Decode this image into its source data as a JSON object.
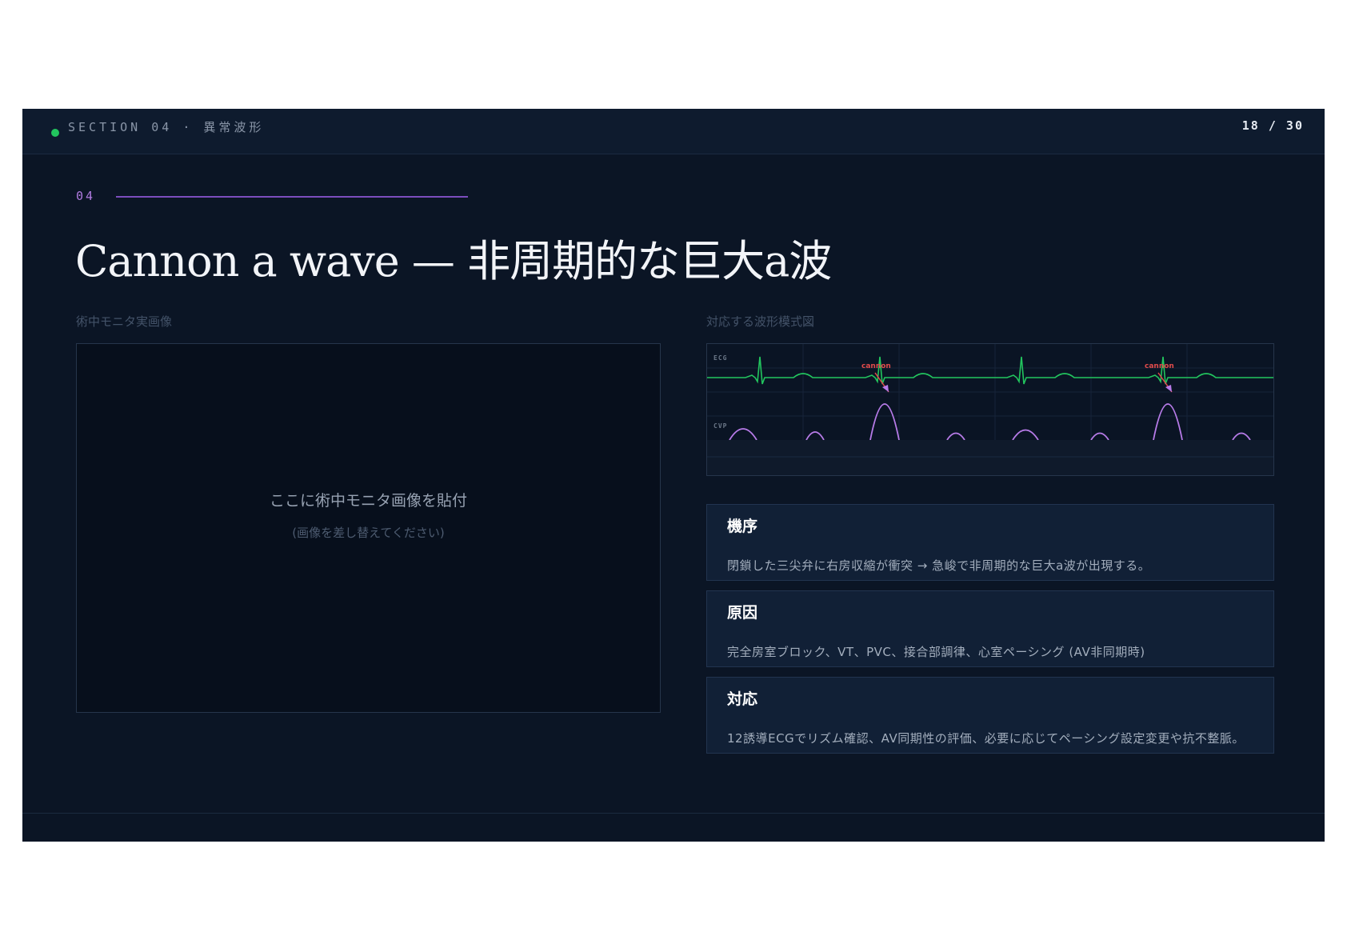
{
  "header": {
    "section_label": "SECTION 04  ·  異常波形",
    "page_number": "18 / 30",
    "status_dot_color": "#22c55e"
  },
  "section_number": "04",
  "title": "Cannon a wave — 非周期的な巨大a波",
  "left_panel": {
    "caption": "術中モニタ実画像",
    "placeholder_main": "ここに術中モニタ画像を貼付",
    "placeholder_sub": "(画像を差し替えてください)"
  },
  "right_panel": {
    "caption": "対応する波形模式図",
    "diagram": {
      "ecg_label": "ECG",
      "cvp_label": "CVP",
      "annotations": [
        "cannon",
        "cannon"
      ],
      "ecg_color": "#22c55e",
      "cvp_color": "#b77be8",
      "arrow_color": "#e04b4b"
    }
  },
  "cards": [
    {
      "title": "機序",
      "body": "閉鎖した三尖弁に右房収縮が衝突 → 急峻で非周期的な巨大a波が出現する。"
    },
    {
      "title": "原因",
      "body": "完全房室ブロック、VT、PVC、接合部調律、心室ペーシング (AV非同期時)"
    },
    {
      "title": "対応",
      "body": "12誘導ECGでリズム確認、AV同期性の評価、必要に応じてペーシング設定変更や抗不整脈。"
    }
  ]
}
